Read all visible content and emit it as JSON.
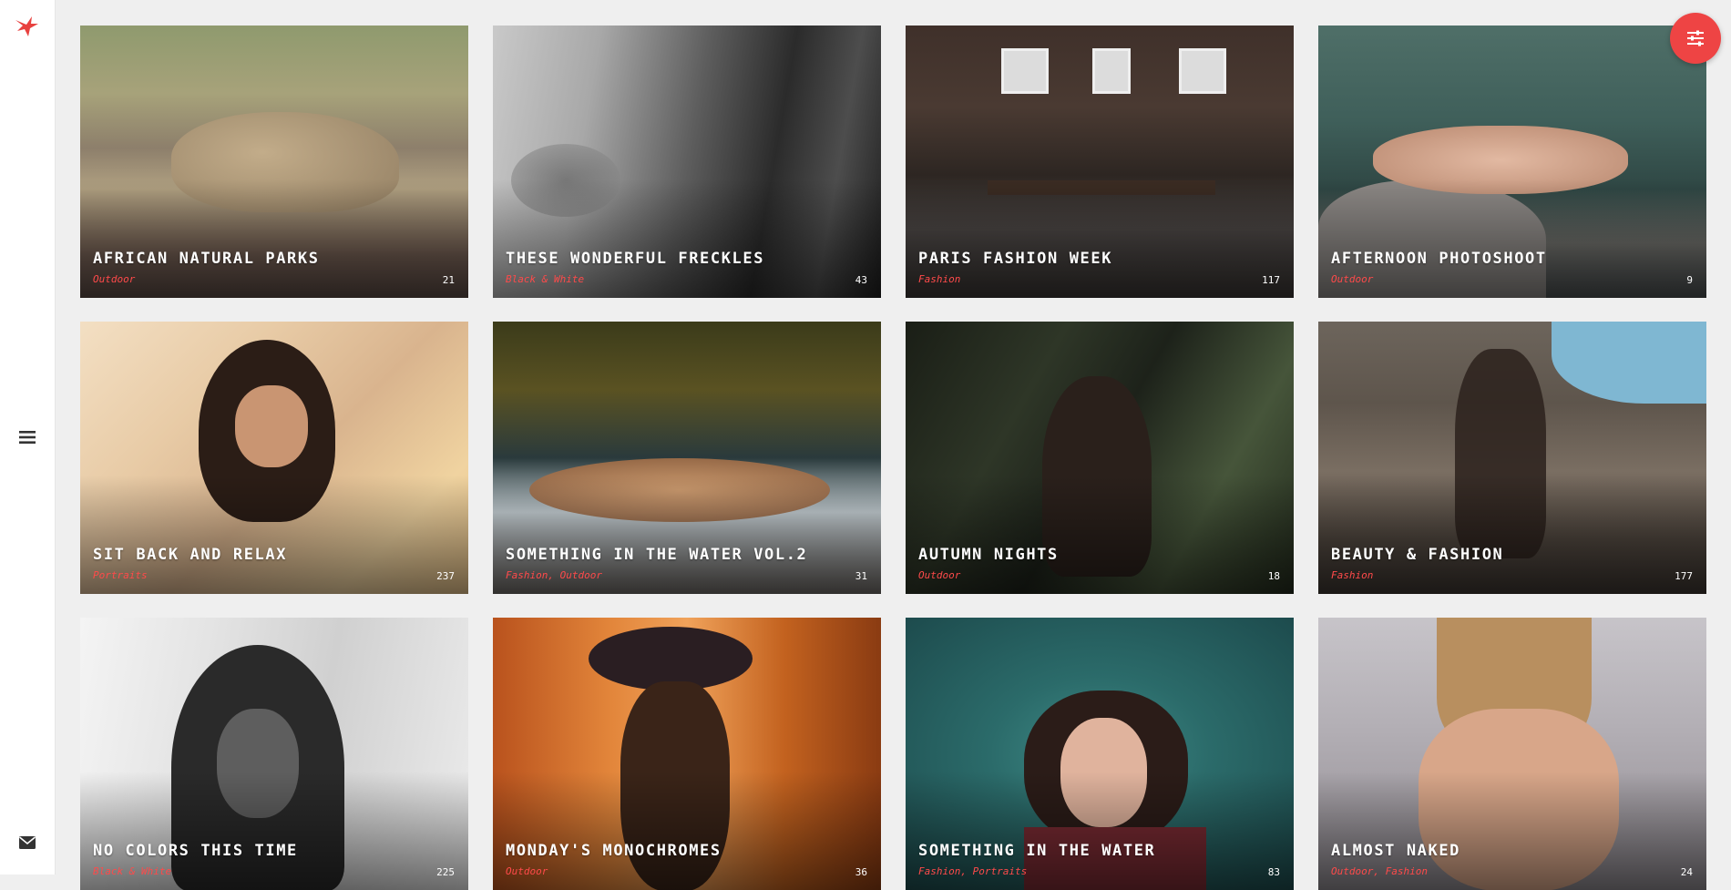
{
  "sidebar": {
    "logo_icon": "bird-logo-icon",
    "menu_icon": "hamburger-menu-icon",
    "contact_icon": "envelope-icon"
  },
  "filter_button": {
    "icon": "sliders-icon",
    "color": "#ee4444"
  },
  "accent_color": "#ff4a4a",
  "albums": [
    {
      "title": "AFRICAN NATURAL PARKS",
      "category": "Outdoor",
      "count": "21"
    },
    {
      "title": "THESE WONDERFUL FRECKLES",
      "category": "Black & White",
      "count": "43"
    },
    {
      "title": "PARIS FASHION WEEK",
      "category": "Fashion",
      "count": "117"
    },
    {
      "title": "AFTERNOON PHOTOSHOOT",
      "category": "Outdoor",
      "count": "9"
    },
    {
      "title": "SIT BACK AND RELAX",
      "category": "Portraits",
      "count": "237"
    },
    {
      "title": "SOMETHING IN THE WATER VOL.2",
      "category": "Fashion, Outdoor",
      "count": "31"
    },
    {
      "title": "AUTUMN NIGHTS",
      "category": "Outdoor",
      "count": "18"
    },
    {
      "title": "BEAUTY & FASHION",
      "category": "Fashion",
      "count": "177"
    },
    {
      "title": "NO COLORS THIS TIME",
      "category": "Black & White",
      "count": "225"
    },
    {
      "title": "MONDAY'S MONOCHROMES",
      "category": "Outdoor",
      "count": "36"
    },
    {
      "title": "SOMETHING IN THE WATER",
      "category": "Fashion, Portraits",
      "count": "83"
    },
    {
      "title": "ALMOST NAKED",
      "category": "Outdoor, Fashion",
      "count": "24"
    }
  ]
}
